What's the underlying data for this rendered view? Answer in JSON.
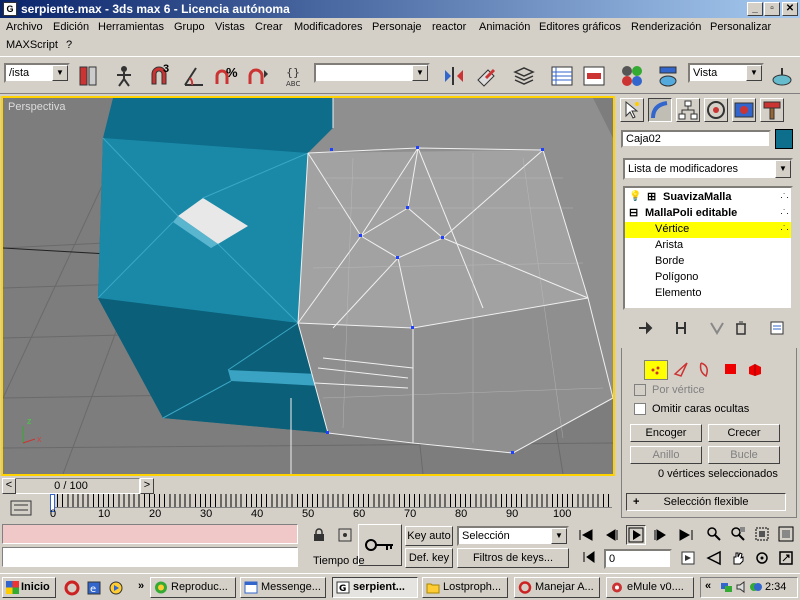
{
  "window": {
    "title": "serpiente.max - 3ds max 6 - Licencia autónoma",
    "controls": [
      "_",
      "▫",
      "✕"
    ]
  },
  "menu": {
    "items": [
      "Archivo",
      "Edición",
      "Herramientas",
      "Grupo",
      "Vistas",
      "Crear",
      "Modificadores",
      "Personaje",
      "reactor",
      "Animación",
      "Editores gráficos",
      "Renderización",
      "Personalizar",
      "MAXScript",
      "?"
    ]
  },
  "toolbar": {
    "view_combo": "/ista",
    "named_selection_combo": "",
    "snap_label": "3",
    "percent_snap_label": "%",
    "render_view_combo": "Vista"
  },
  "viewport": {
    "label": "Perspectiva",
    "object_color": "#0e6f8c",
    "background": "#7d7d7d",
    "axis_labels": {
      "x": "x",
      "z": "z"
    }
  },
  "command_panel": {
    "object_name": "Caja02",
    "object_color": "#0e6f8c",
    "modifier_list": "Lista de modificadores",
    "stack": [
      {
        "label": "SuavizaMalla",
        "prefix": "⊞"
      },
      {
        "label": "MallaPoli editable",
        "prefix": "⊟"
      },
      {
        "label": "Vértice",
        "selected": true
      },
      {
        "label": "Arista"
      },
      {
        "label": "Borde"
      },
      {
        "label": "Polígono"
      },
      {
        "label": "Elemento"
      }
    ],
    "selection": {
      "by_vertex": "Por vértice",
      "ignore_backfacing": "Omitir caras ocultas",
      "shrink": "Encoger",
      "grow": "Crecer",
      "ring": "Anillo",
      "loop": "Bucle",
      "status": "0 vértices seleccionados",
      "soft_selection": "Selección flexible",
      "soft_selection_sign": "+"
    }
  },
  "timeline": {
    "slider": "0 / 100",
    "prev": "<",
    "next": ">",
    "ticks": [
      "0",
      "10",
      "20",
      "30",
      "40",
      "50",
      "60",
      "70",
      "80",
      "90",
      "100"
    ]
  },
  "status": {
    "time_tag": "Tiempo de",
    "key_auto": "Key auto",
    "def_key": "Def. key",
    "key_mode_combo": "Selección",
    "key_filters": "Filtros de keys...",
    "frame_field": "0"
  },
  "taskbar": {
    "start": "Inicio",
    "tasks": [
      {
        "label": "Reproduc...",
        "active": false
      },
      {
        "label": "Messenge...",
        "active": false
      },
      {
        "label": "serpient...",
        "active": true
      },
      {
        "label": "Lostproph...",
        "active": false
      },
      {
        "label": "Manejar A...",
        "active": false
      },
      {
        "label": "eMule v0....",
        "active": false
      }
    ],
    "overflow": "»",
    "tray_overflow": "«",
    "clock": "2:34"
  }
}
